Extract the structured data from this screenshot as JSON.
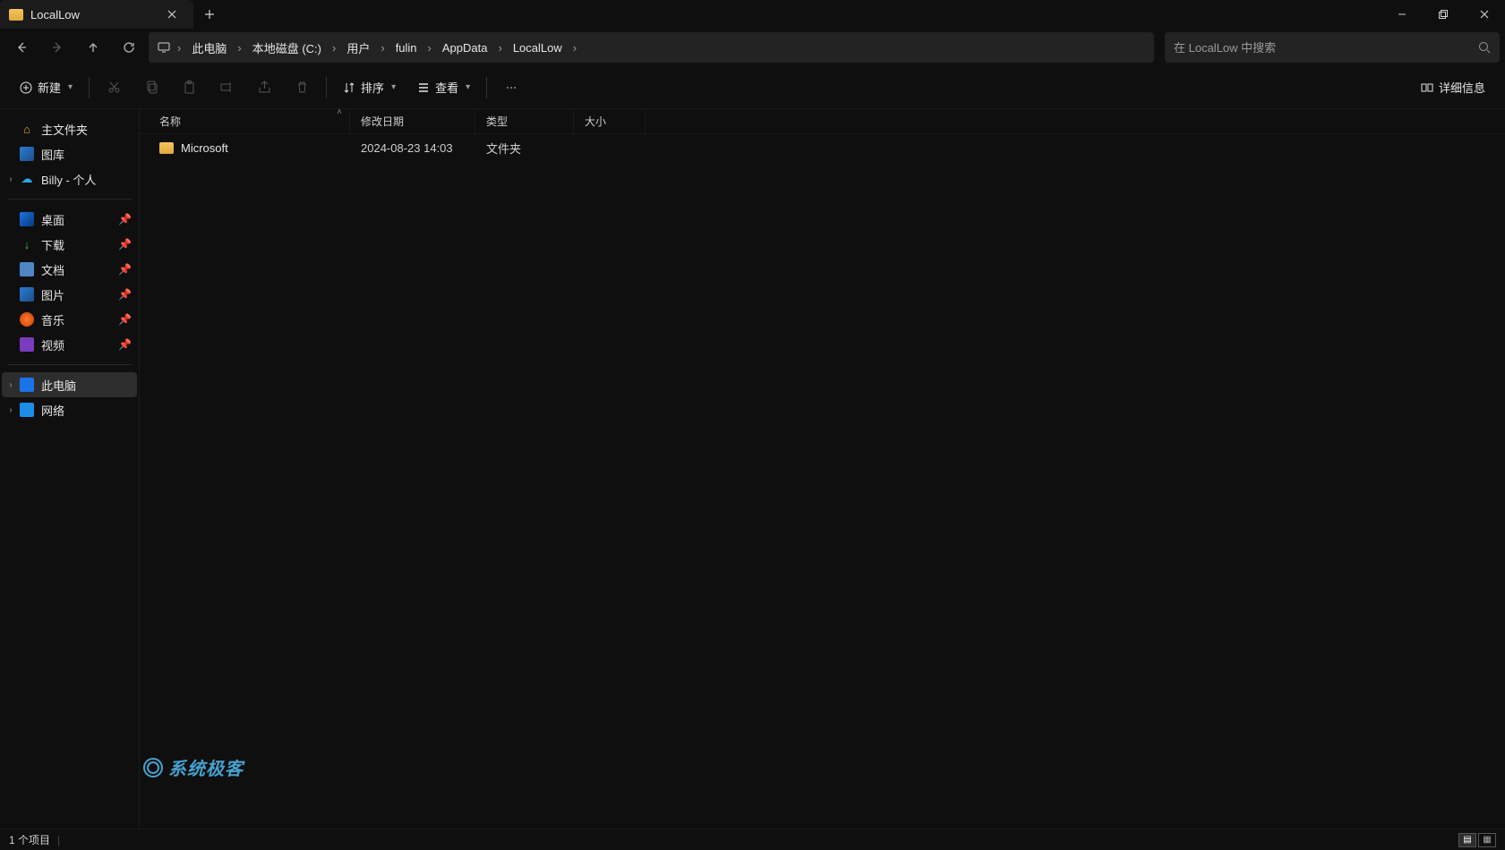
{
  "titlebar": {
    "tab_label": "LocalLow"
  },
  "address": {
    "crumbs": [
      "此电脑",
      "本地磁盘 (C:)",
      "用户",
      "fulin",
      "AppData",
      "LocalLow"
    ],
    "search_placeholder": "在 LocalLow 中搜索"
  },
  "toolbar": {
    "new_label": "新建",
    "sort_label": "排序",
    "view_label": "查看",
    "details_label": "详细信息"
  },
  "sidebar": {
    "home": "主文件夹",
    "gallery": "图库",
    "onedrive": "Billy - 个人",
    "quick": {
      "desktop": "桌面",
      "downloads": "下载",
      "documents": "文档",
      "pictures": "图片",
      "music": "音乐",
      "video": "视频"
    },
    "pc": "此电脑",
    "network": "网络"
  },
  "columns": {
    "name": "名称",
    "date": "修改日期",
    "type": "类型",
    "size": "大小"
  },
  "rows": [
    {
      "name": "Microsoft",
      "date": "2024-08-23 14:03",
      "type": "文件夹",
      "size": ""
    }
  ],
  "status": {
    "count": "1 个项目"
  },
  "watermark": "系统极客"
}
